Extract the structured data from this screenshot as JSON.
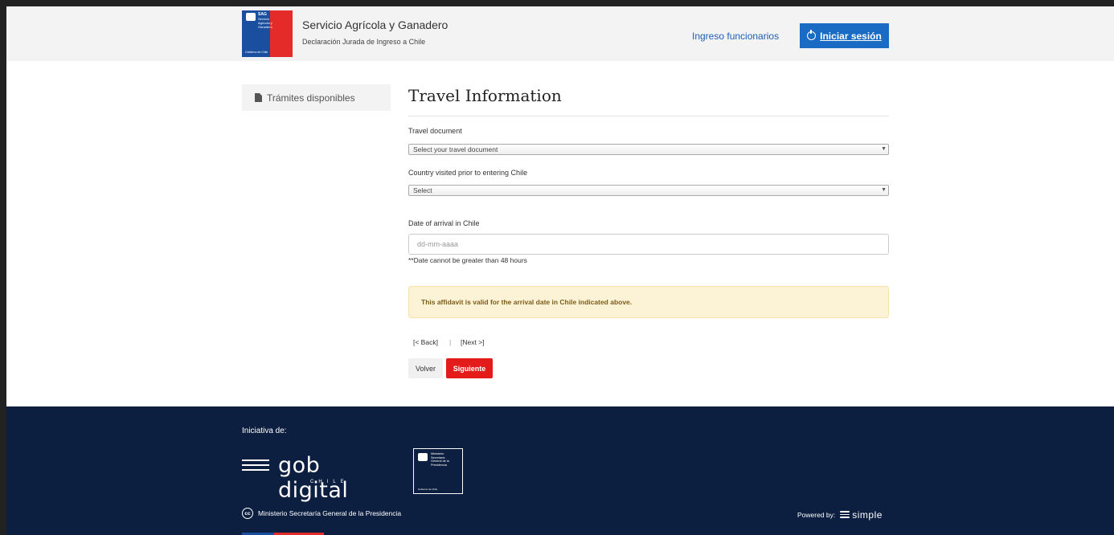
{
  "header": {
    "logo": {
      "agency": "SAG",
      "agency_lines": [
        "Servicio",
        "Agrícola y",
        "Ganadero"
      ],
      "footer": "Gobierno de Chile"
    },
    "title": "Servicio Agrícola y Ganadero",
    "subtitle": "Declaración Jurada de Ingreso a Chile",
    "staff_link": "Ingreso funcionarios",
    "login_label": "Iniciar sesión"
  },
  "sidebar": {
    "items": [
      {
        "label": "Trámites disponibles",
        "icon": "document-icon"
      }
    ]
  },
  "main": {
    "title": "Travel Information",
    "fields": {
      "travel_document": {
        "label": "Travel document",
        "selected": "Select your travel document"
      },
      "country_visited": {
        "label": "Country visited prior to entering Chile",
        "selected": "Select"
      },
      "arrival_date": {
        "label": "Date of arrival in Chile",
        "placeholder": "dd-mm-aaaa",
        "help": "**Date cannot be greater than 48 hours"
      }
    },
    "alert": "This affidavit is valid for the arrival date in Chile indicated above.",
    "pager": {
      "back": "[< Back]",
      "separator": "|",
      "next": "[Next >]"
    },
    "buttons": {
      "back": "Volver",
      "next": "Siguiente"
    }
  },
  "footer": {
    "initiative_label": "Iniciativa de:",
    "gob_digital": {
      "word": "gob digital",
      "country": "CHILE"
    },
    "ministry_box": {
      "lines": [
        "Ministerio",
        "Secretaría",
        "General de la",
        "Presidencia"
      ],
      "footer": "Gobierno de Chile"
    },
    "ministry_name": "Ministerio Secretaría General de la Presidencia",
    "license_icon": "cc",
    "powered_by": "Powered by:",
    "powered_brand": "simple"
  },
  "colors": {
    "accent_blue": "#1a6bc4",
    "accent_red": "#e41b1b",
    "footer_bg": "#0d1f40",
    "alert_bg": "#fcf3d6"
  }
}
